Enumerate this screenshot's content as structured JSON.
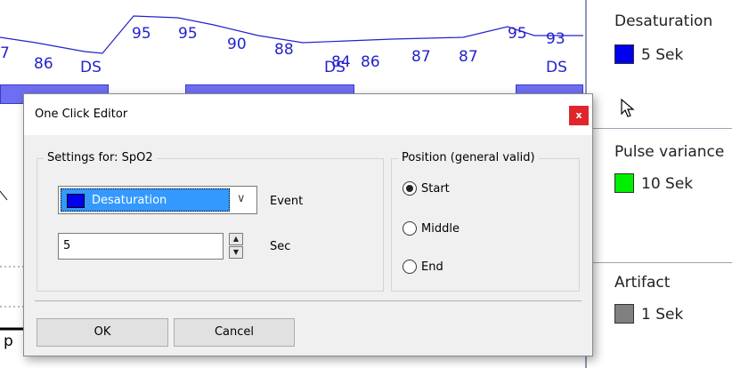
{
  "plot": {
    "values": [
      "7",
      "86",
      "95",
      "95",
      "90",
      "88",
      "84",
      "86",
      "87",
      "87",
      "95",
      "93"
    ],
    "event_labels": [
      "DS",
      "DS",
      "DS"
    ],
    "bottom_letter": "p"
  },
  "legend_panel": {
    "items": [
      {
        "title": "Desaturation",
        "duration": "5 Sek",
        "color": "#0000ee"
      },
      {
        "title": "Pulse variance",
        "duration": "10 Sek",
        "color": "#00ee00"
      },
      {
        "title": "Artifact",
        "duration": "1 Sek",
        "color": "#808080"
      }
    ]
  },
  "dialog": {
    "title": "One Click Editor",
    "close_symbol": "x",
    "settings_legend": "Settings for: SpO2",
    "event_select_value": "Desaturation",
    "event_select_color": "#0000ee",
    "event_label": "Event",
    "sec_value": "5",
    "sec_label": "Sec",
    "position_legend": "Position (general valid)",
    "positions": [
      {
        "label": "Start",
        "checked": true
      },
      {
        "label": "Middle",
        "checked": false
      },
      {
        "label": "End",
        "checked": false
      }
    ],
    "ok_label": "OK",
    "cancel_label": "Cancel"
  },
  "cursor_icon": "mouse-pointer-icon"
}
